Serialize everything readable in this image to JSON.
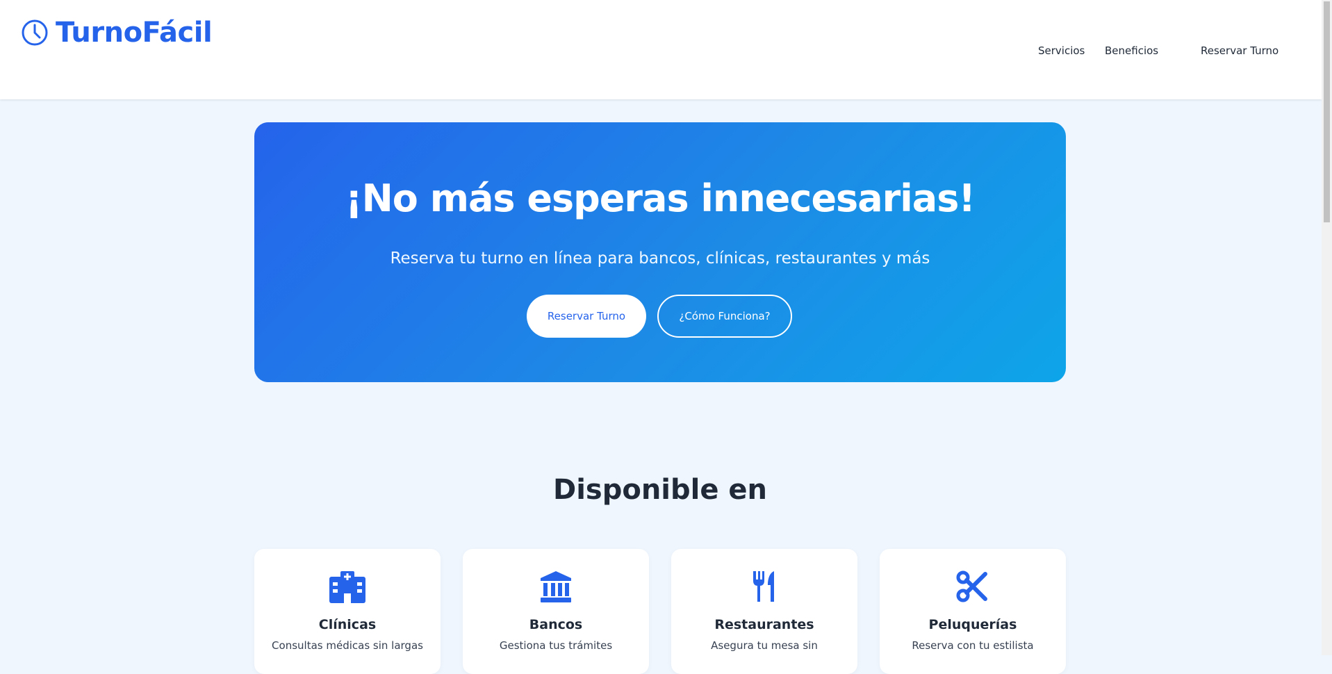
{
  "brand": {
    "name": "TurnoFácil",
    "icon": "clock-icon",
    "color": "#2563eb"
  },
  "nav": {
    "items": [
      "Servicios",
      "Beneficios",
      "Reservar Turno"
    ]
  },
  "hero": {
    "title": "¡No más esperas innecesarias!",
    "subtitle": "Reserva tu turno en línea para bancos, clínicas, restaurantes y más",
    "primary_button": "Reservar Turno",
    "secondary_button": "¿Cómo Funciona?"
  },
  "services": {
    "title": "Disponible en",
    "cards": [
      {
        "icon": "hospital-icon",
        "title": "Clínicas",
        "desc": "Consultas médicas sin largas"
      },
      {
        "icon": "bank-icon",
        "title": "Bancos",
        "desc": "Gestiona tus trámites"
      },
      {
        "icon": "utensils-icon",
        "title": "Restaurantes",
        "desc": "Asegura tu mesa sin"
      },
      {
        "icon": "scissors-icon",
        "title": "Peluquerías",
        "desc": "Reserva con tu estilista"
      }
    ]
  }
}
